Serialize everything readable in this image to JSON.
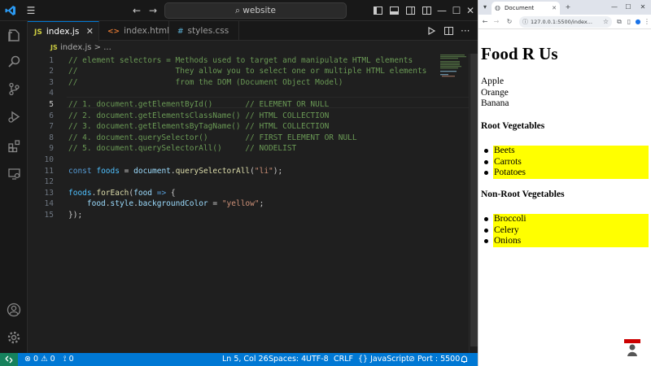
{
  "window": {
    "search_text": "website"
  },
  "tabs": [
    {
      "icon": "JS",
      "label": "index.js",
      "color": "#cbcb41",
      "active": true
    },
    {
      "icon": "<>",
      "label": "index.html",
      "color": "#e37933",
      "active": false
    },
    {
      "icon": "#",
      "label": "styles.css",
      "color": "#519aba",
      "active": false
    }
  ],
  "breadcrumb": {
    "icon": "JS",
    "file": "index.js",
    "sep": ">",
    "more": "..."
  },
  "code_lines": [
    {
      "n": "1",
      "text": "// element selectors = Methods used to target and manipulate HTML elements"
    },
    {
      "n": "2",
      "text": "//                     They allow you to select one or multiple HTML elements"
    },
    {
      "n": "3",
      "text": "//                     from the DOM (Document Object Model)"
    },
    {
      "n": "4",
      "text": ""
    },
    {
      "n": "5",
      "text": "// 1. document.getElementById()       // ELEMENT OR NULL"
    },
    {
      "n": "6",
      "text": "// 2. document.getElementsClassName() // HTML COLLECTION"
    },
    {
      "n": "7",
      "text": "// 3. document.getElementsByTagName() // HTML COLLECTION"
    },
    {
      "n": "8",
      "text": "// 4. document.querySelector()        // FIRST ELEMENT OR NULL"
    },
    {
      "n": "9",
      "text": "// 5. document.querySelectorAll()     // NODELIST"
    },
    {
      "n": "10",
      "text": ""
    },
    {
      "n": "11",
      "text": "const foods = document.querySelectorAll(\"li\");"
    },
    {
      "n": "12",
      "text": ""
    },
    {
      "n": "13",
      "text": "foods.forEach(food => {"
    },
    {
      "n": "14",
      "text": "    food.style.backgroundColor = \"yellow\";"
    },
    {
      "n": "15",
      "text": "});"
    }
  ],
  "statusbar": {
    "errors": "0",
    "warnings": "0",
    "ports": "0",
    "position": "Ln 5, Col 26",
    "spaces": "Spaces: 4",
    "encoding": "UTF-8",
    "eol": "CRLF",
    "language_brace": "{}",
    "language": "JavaScript",
    "port": "Port : 5500"
  },
  "browser": {
    "tab_title": "Document",
    "url": "127.0.0.1:5500/index..."
  },
  "webpage": {
    "title": "Food R Us",
    "plain_items": [
      "Apple",
      "Orange",
      "Banana"
    ],
    "sections": [
      {
        "heading": "Root Vegetables",
        "items": [
          "Beets",
          "Carrots",
          "Potatoes"
        ]
      },
      {
        "heading": "Non-Root Vegetables",
        "items": [
          "Broccoli",
          "Celery",
          "Onions"
        ]
      }
    ],
    "highlight_color": "#ffff00"
  },
  "colors": {
    "accent": "#0078d4",
    "remote": "#16825d",
    "editor_bg": "#1f1f1f"
  }
}
